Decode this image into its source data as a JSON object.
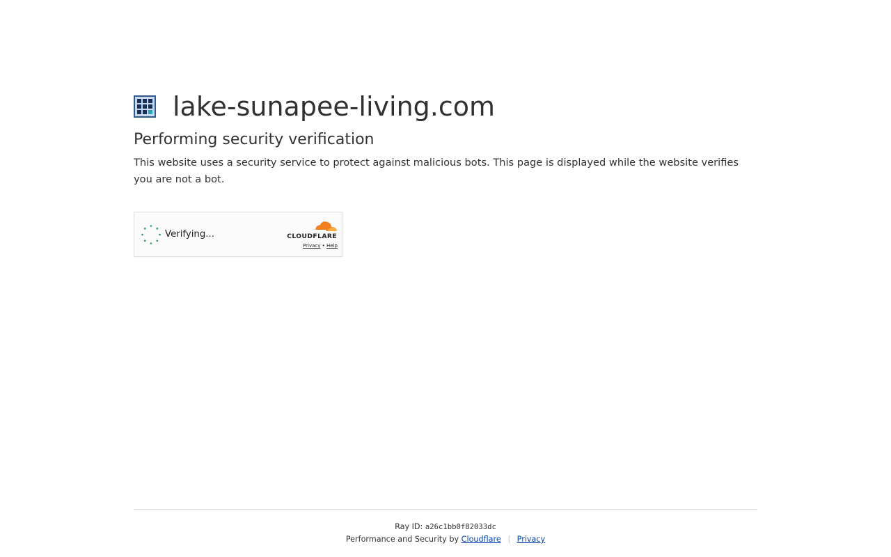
{
  "site": {
    "name": "lake-sunapee-living.com"
  },
  "verification": {
    "heading": "Performing security verification",
    "description": "This website uses a security service to protect against malicious bots. This page is displayed while the website verifies you are not a bot."
  },
  "widget": {
    "status": "Verifying...",
    "brand": "CLOUDFLARE",
    "privacy_label": "Privacy",
    "link_separator": "•",
    "help_label": "Help"
  },
  "footer": {
    "ray_label": "Ray ID:",
    "ray_id": "a26c1bb0f82033dc",
    "performance_text": "Performance and Security by",
    "cloudflare_link": "Cloudflare",
    "separator": "|",
    "privacy_link": "Privacy"
  },
  "colors": {
    "text": "#313131",
    "link": "#0645ad",
    "spinner": "#2c9b5a",
    "cloudflare_orange": "#f38020",
    "cloudflare_light_orange": "#faae40"
  },
  "icons": {
    "favicon": "site-grid-favicon",
    "spinner": "loading-spinner-icon",
    "cloudflare": "cloudflare-cloud-logo"
  }
}
